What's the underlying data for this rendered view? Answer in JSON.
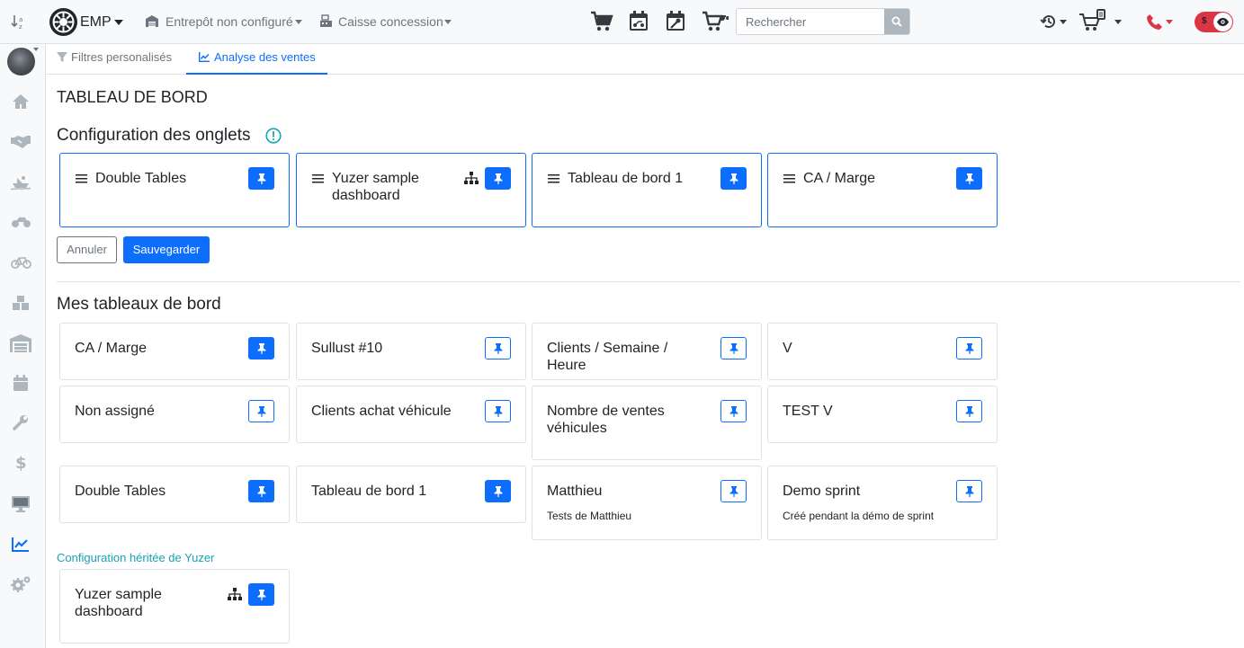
{
  "topbar": {
    "brand": "EMP",
    "warehouse": "Entrepôt non configuré",
    "register": "Caisse concession",
    "search_placeholder": "Rechercher",
    "toggle_badge": "$"
  },
  "tabs": [
    {
      "label": "Filtres personalisés",
      "icon": "filter-icon"
    },
    {
      "label": "Analyse des ventes",
      "icon": "chart-line-icon"
    }
  ],
  "page_title": "TABLEAU DE BORD",
  "config_section": {
    "title": "Configuration des onglets",
    "cards": [
      {
        "title": "Double Tables",
        "pinned": true,
        "shared": false
      },
      {
        "title": "Yuzer sample dashboard",
        "pinned": true,
        "shared": true
      },
      {
        "title": "Tableau de bord 1",
        "pinned": true,
        "shared": false
      },
      {
        "title": "CA / Marge",
        "pinned": true,
        "shared": false
      }
    ],
    "cancel_label": "Annuler",
    "save_label": "Sauvegarder"
  },
  "my_dashboards": {
    "title": "Mes tableaux de bord",
    "cards": [
      {
        "title": "CA / Marge",
        "pinned": true
      },
      {
        "title": "Sullust #10",
        "pinned": false
      },
      {
        "title": "Clients / Semaine / Heure",
        "pinned": false
      },
      {
        "title": "V",
        "pinned": false
      },
      {
        "title": "Non assigné",
        "pinned": false
      },
      {
        "title": "Clients achat véhicule",
        "pinned": false
      },
      {
        "title": "Nombre de ventes véhicules",
        "pinned": false
      },
      {
        "title": "TEST V",
        "pinned": false
      },
      {
        "title": "Double Tables",
        "pinned": true
      },
      {
        "title": "Tableau de bord 1",
        "pinned": true
      },
      {
        "title": "Matthieu",
        "subtitle": "Tests de Matthieu",
        "pinned": false
      },
      {
        "title": "Demo sprint",
        "subtitle": "Créé pendant la démo de sprint",
        "pinned": false
      }
    ]
  },
  "inherited": {
    "label": "Configuration héritée de Yuzer",
    "cards": [
      {
        "title": "Yuzer sample dashboard",
        "pinned": true,
        "shared": true
      }
    ]
  },
  "colors": {
    "primary": "#0d6efd",
    "info": "#17a2b8",
    "danger": "#dc3545",
    "muted": "#6c757d"
  }
}
